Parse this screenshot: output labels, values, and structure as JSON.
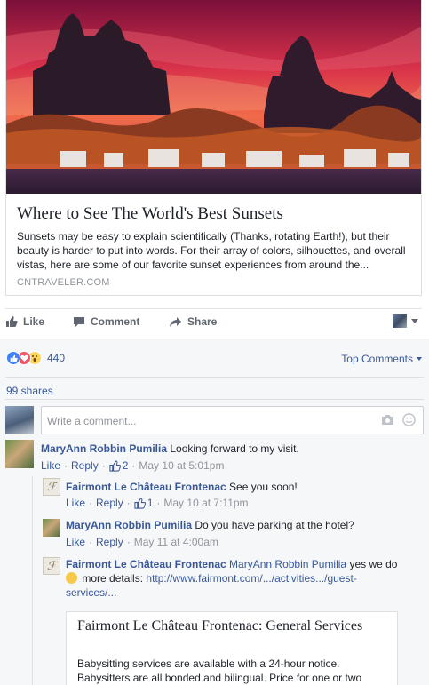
{
  "post": {
    "link_card": {
      "image_alt": "Quebec City skyline at sunset",
      "title": "Where to See The World's Best Sunsets",
      "description": "Sunsets may be easy to explain scientifically (Thanks, rotating Earth!), but their beauty is harder to put into words. For their array of colors, silhouettes, and overall vistas, here are some of our favorite sunset experiences from around the...",
      "domain": "CNTRAVELER.COM"
    },
    "actions": {
      "like": "Like",
      "comment": "Comment",
      "share": "Share"
    }
  },
  "reactions": {
    "count": "440",
    "sort_label": "Top Comments",
    "shares": "99 shares"
  },
  "composer": {
    "placeholder": "Write a comment..."
  },
  "comments": [
    {
      "author": "MaryAnn Robbin Pumilia",
      "text": "Looking forward to my visit.",
      "like": "Like",
      "reply": "Reply",
      "likes": "2",
      "time": "May 10 at 5:01pm",
      "replies": [
        {
          "author": "Fairmont Le Château Frontenac",
          "text": "See you soon!",
          "like": "Like",
          "reply": "Reply",
          "likes": "1",
          "time": "May 10 at 7:11pm"
        },
        {
          "author": "MaryAnn Robbin Pumilia",
          "text": "Do you have parking at the hotel?",
          "like": "Like",
          "reply": "Reply",
          "time": "May 11 at 4:00am"
        },
        {
          "author": "Fairmont Le Château Frontenac",
          "mention": "MaryAnn Robbin Pumilia",
          "text_before": "yes we do",
          "text_after": "more details:",
          "link": "http://www.fairmont.com/.../activities.../guest-services/...",
          "link_line1": "http://www.fairmont.com/.../activities.../guest-",
          "link_line2": "services/...",
          "preview": {
            "title": "Fairmont Le Château Frontenac: General Services",
            "description": "Babysitting services are available with a 24-hour notice. Babysitters are all bonded and bilingual. Price for one or two"
          }
        }
      ]
    }
  ],
  "colors": {
    "link_blue": "#385898",
    "meta_gray": "#90949c",
    "like_blue": "#4080ff",
    "love_red": "#f25268",
    "wow_yellow": "#fcd55c"
  }
}
